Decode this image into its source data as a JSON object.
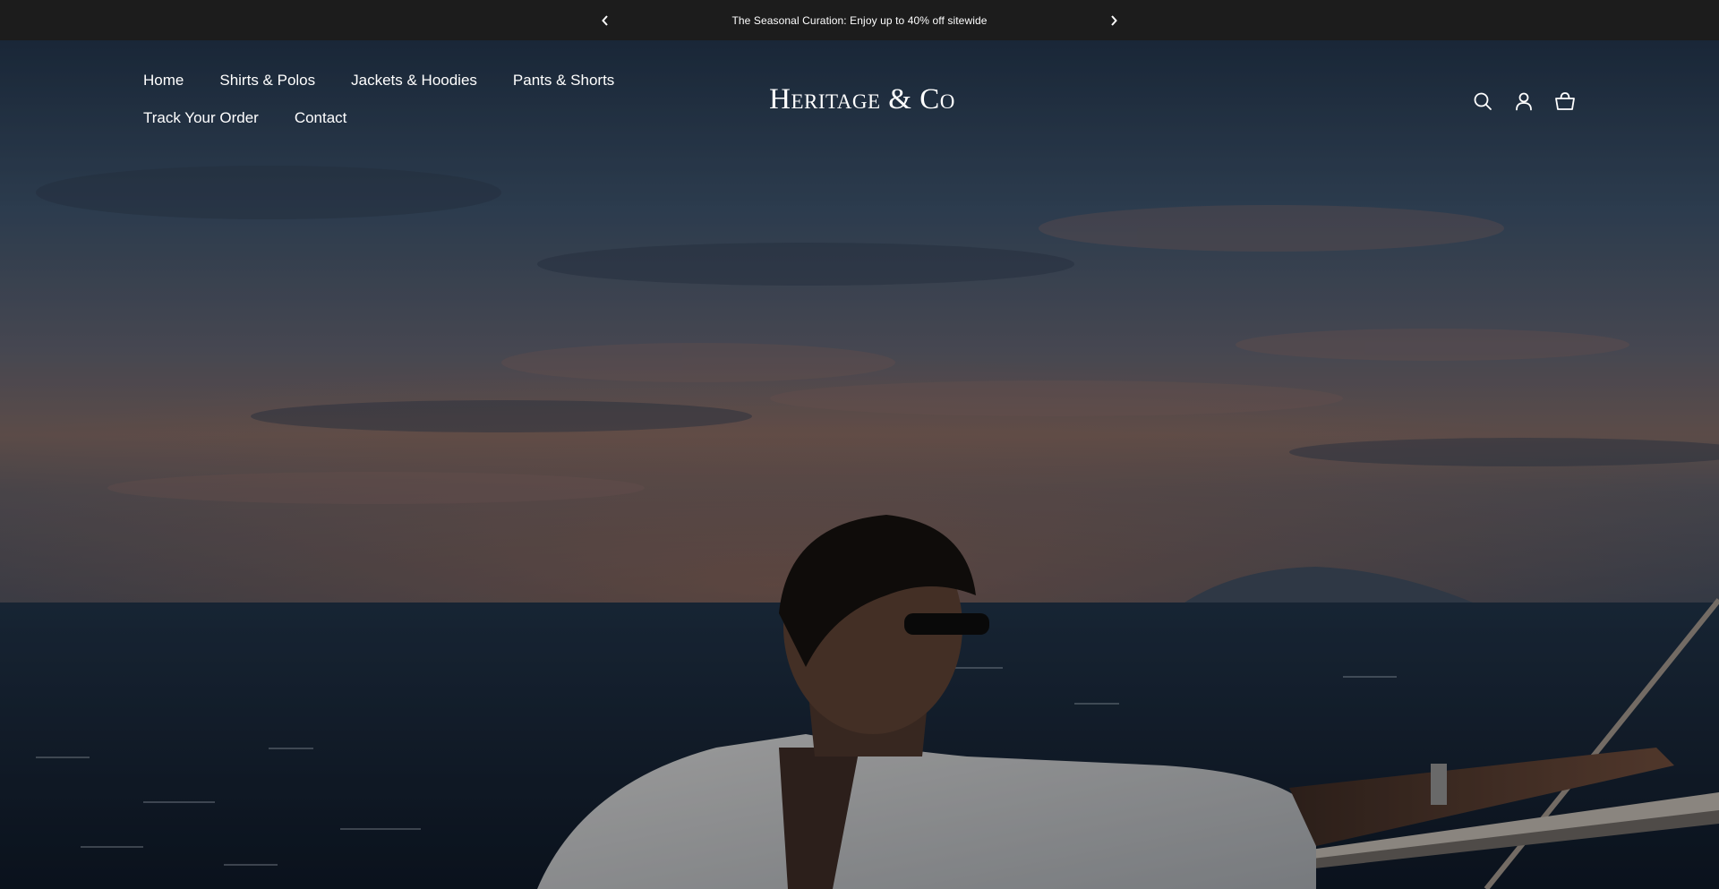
{
  "announcement": {
    "text": "The Seasonal Curation: Enjoy up to 40% off sitewide",
    "prev_icon": "chevron-left-icon",
    "next_icon": "chevron-right-icon",
    "background": "#1c1c1c"
  },
  "nav": {
    "items": [
      {
        "label": "Home"
      },
      {
        "label": "Shirts & Polos"
      },
      {
        "label": "Jackets & Hoodies"
      },
      {
        "label": "Pants & Shorts"
      },
      {
        "label": "Track Your Order"
      },
      {
        "label": "Contact"
      }
    ]
  },
  "logo": {
    "text": "Heritage & Co"
  },
  "header_icons": [
    "search-icon",
    "account-icon",
    "cart-icon"
  ],
  "hero": {
    "image": "man-on-sailboat-at-sunset"
  }
}
